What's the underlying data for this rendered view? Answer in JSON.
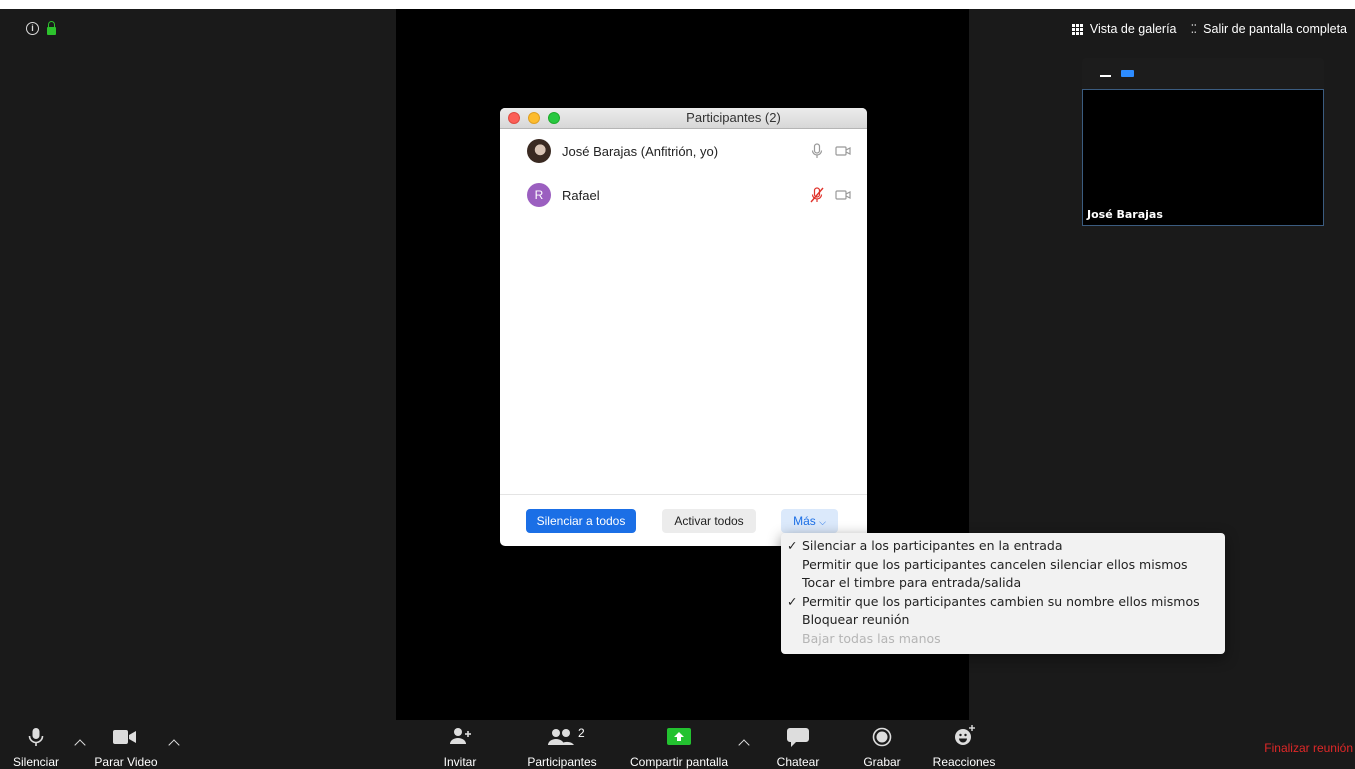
{
  "top_left": {
    "info_icon": "info-icon",
    "lock_icon": "lock-icon",
    "lock_color": "#2dc22d"
  },
  "top_right": {
    "gallery_label": "Vista de galería",
    "exit_fullscreen_label": "Salir de pantalla completa"
  },
  "thumbnail": {
    "name": "José Barajas",
    "accent": "#2d8cff"
  },
  "participants_window": {
    "title": "Participantes (2)",
    "participants": [
      {
        "name": "José Barajas (Anfitrión, yo)",
        "avatar": "photo",
        "mic": "on",
        "video": "off"
      },
      {
        "name": "Rafael",
        "avatar_letter": "R",
        "avatar_color": "#9b5fc0",
        "mic": "muted",
        "video": "off"
      }
    ],
    "buttons": {
      "mute_all": "Silenciar a todos",
      "unmute_all": "Activar todos",
      "more": "Más"
    }
  },
  "more_menu": {
    "items": [
      {
        "label": "Silenciar a los participantes en la entrada",
        "checked": true,
        "enabled": true
      },
      {
        "label": "Permitir que los participantes cancelen silenciar ellos mismos",
        "checked": false,
        "enabled": true
      },
      {
        "label": "Tocar el timbre para entrada/salida",
        "checked": false,
        "enabled": true
      },
      {
        "label": "Permitir que los participantes cambien su nombre ellos mismos",
        "checked": true,
        "enabled": true
      },
      {
        "label": "Bloquear reunión",
        "checked": false,
        "enabled": true
      },
      {
        "label": "Bajar todas las manos",
        "checked": false,
        "enabled": false
      }
    ],
    "check_mark": "✓"
  },
  "toolbar": {
    "mute": "Silenciar",
    "stop_video": "Parar Video",
    "invite": "Invitar",
    "participants": "Participantes",
    "participants_count": "2",
    "share_screen": "Compartir pantalla",
    "chat": "Chatear",
    "record": "Grabar",
    "reactions": "Reacciones",
    "end_meeting": "Finalizar reunión",
    "share_color": "#23c230",
    "end_color": "#e02828"
  }
}
